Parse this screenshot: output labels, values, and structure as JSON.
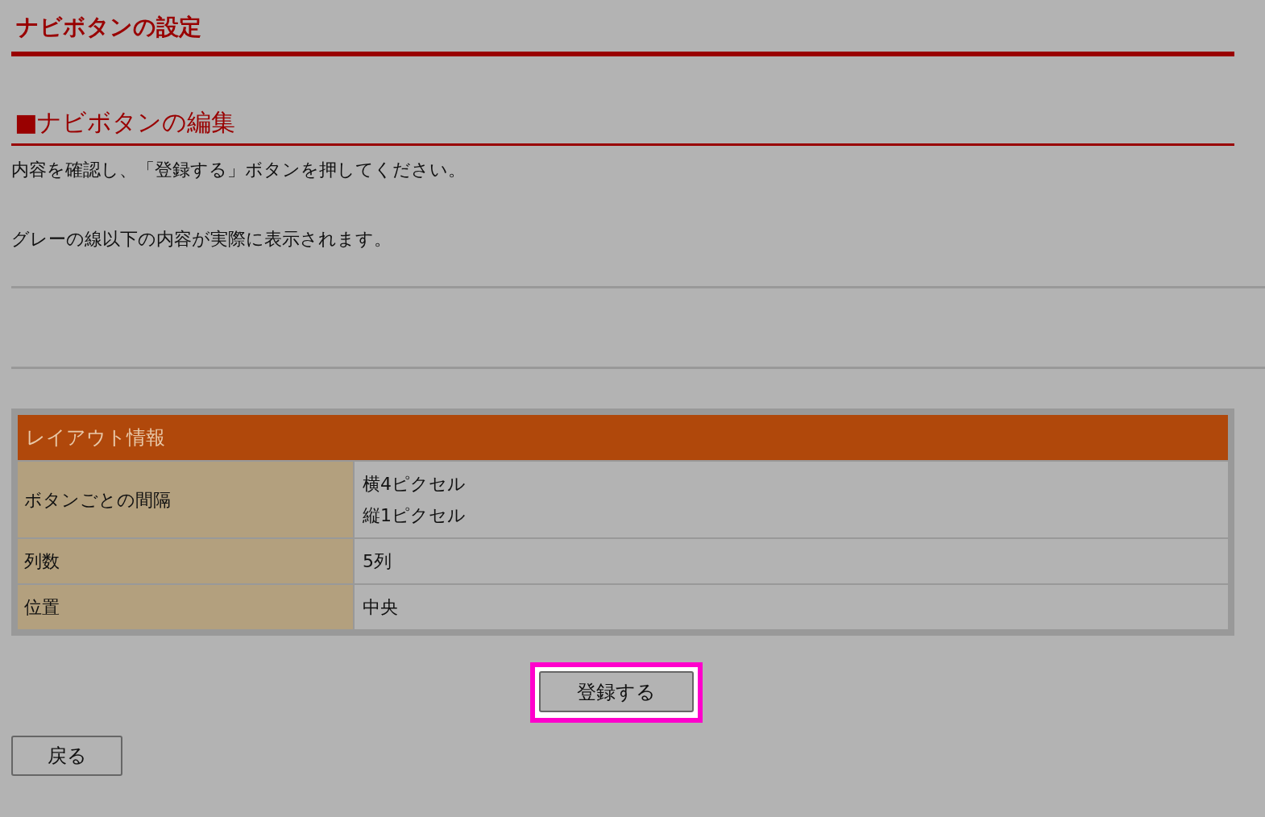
{
  "page_title": "ナビボタンの設定",
  "section_title": "■ナビボタンの編集",
  "instructions": [
    "内容を確認し、「登録する」ボタンを押してください。",
    "グレーの線以下の内容が実際に表示されます。"
  ],
  "table": {
    "title": "レイアウト情報",
    "rows": [
      {
        "label": "ボタンごとの間隔",
        "values": [
          "横4ピクセル",
          "縦1ピクセル"
        ]
      },
      {
        "label": "列数",
        "values": [
          "5列"
        ]
      },
      {
        "label": "位置",
        "values": [
          "中央"
        ]
      }
    ]
  },
  "submit_button": {
    "label": "登録する",
    "highlighted": true
  },
  "back_button": {
    "label": "戻る"
  }
}
